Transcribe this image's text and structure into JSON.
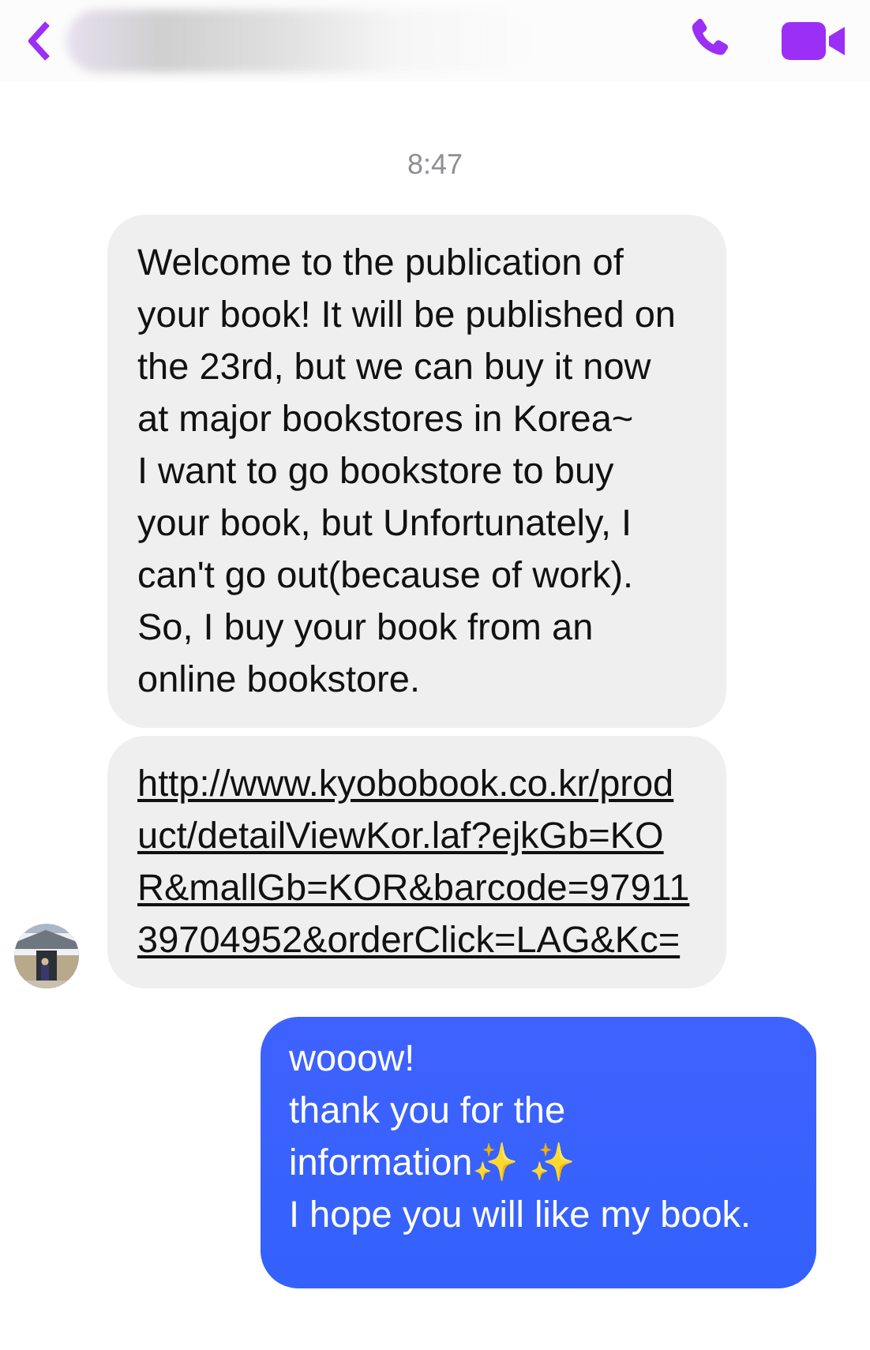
{
  "timestamp": "8:47",
  "messages": [
    {
      "kind": "received",
      "avatar": false,
      "text": "Welcome to the publication of your book! It will be published on the 23rd, but we can buy it now at major bookstores in Korea~\nI want to go bookstore to buy your book, but Unfortunately, I can't go out(because of work).\nSo, I buy your book from an online bookstore."
    },
    {
      "kind": "link",
      "avatar": true,
      "text": "http://www.kyobobook.co.kr/product/detailViewKor.laf?ejkGb=KOR&mallGb=KOR&barcode=9791139704952&orderClick=LAG&Kc="
    },
    {
      "kind": "sent",
      "avatar": false,
      "text": "wooow!\nthank you for the information✨ ✨\nI hope you will like my book."
    }
  ]
}
